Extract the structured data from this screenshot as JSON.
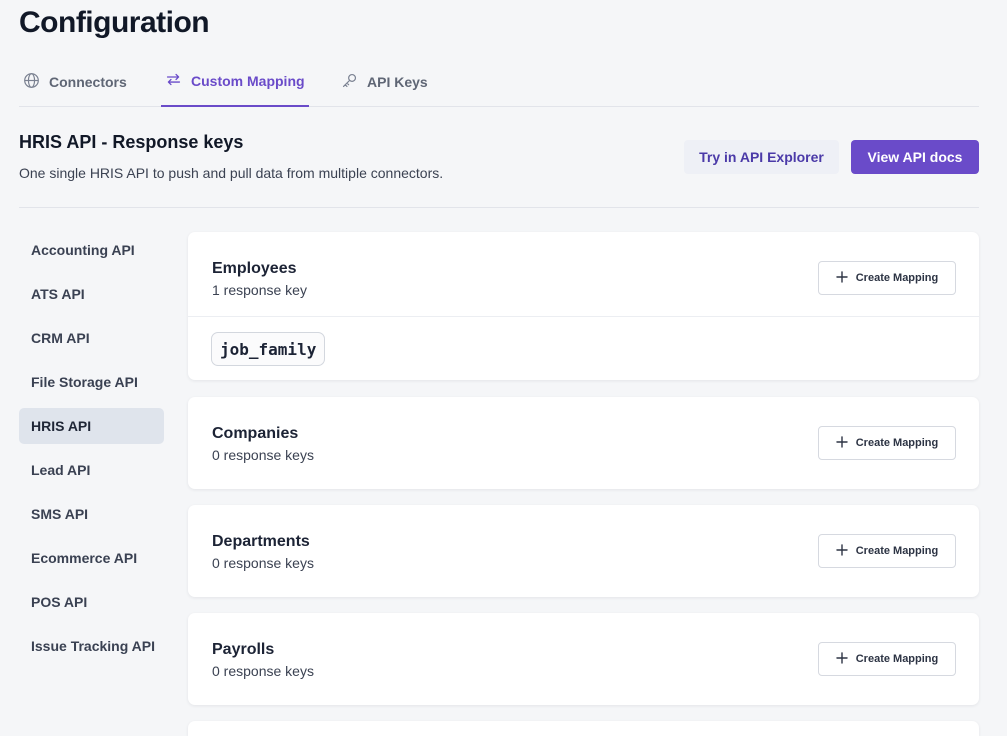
{
  "page": {
    "title": "Configuration"
  },
  "tabs": [
    {
      "label": "Connectors",
      "icon": "globe-icon"
    },
    {
      "label": "Custom Mapping",
      "icon": "swap-arrows-icon",
      "active": true
    },
    {
      "label": "API Keys",
      "icon": "key-icon"
    }
  ],
  "section": {
    "title": "HRIS API - Response keys",
    "subtitle": "One single HRIS API to push and pull data from multiple connectors.",
    "explorer_button": "Try in API Explorer",
    "docs_button": "View API docs"
  },
  "sidebar": {
    "items": [
      {
        "label": "Accounting API"
      },
      {
        "label": "ATS API"
      },
      {
        "label": "CRM API"
      },
      {
        "label": "File Storage API"
      },
      {
        "label": "HRIS API",
        "active": true
      },
      {
        "label": "Lead API"
      },
      {
        "label": "SMS API"
      },
      {
        "label": "Ecommerce API"
      },
      {
        "label": "POS API"
      },
      {
        "label": "Issue Tracking API"
      }
    ]
  },
  "cards": [
    {
      "title": "Employees",
      "count": "1 response key",
      "button": "Create Mapping",
      "keys": [
        "job_family"
      ]
    },
    {
      "title": "Companies",
      "count": "0 response keys",
      "button": "Create Mapping"
    },
    {
      "title": "Departments",
      "count": "0 response keys",
      "button": "Create Mapping"
    },
    {
      "title": "Payrolls",
      "count": "0 response keys",
      "button": "Create Mapping"
    }
  ],
  "colors": {
    "accent": "#6a4bc9",
    "background": "#f5f6f8",
    "card": "#ffffff"
  }
}
